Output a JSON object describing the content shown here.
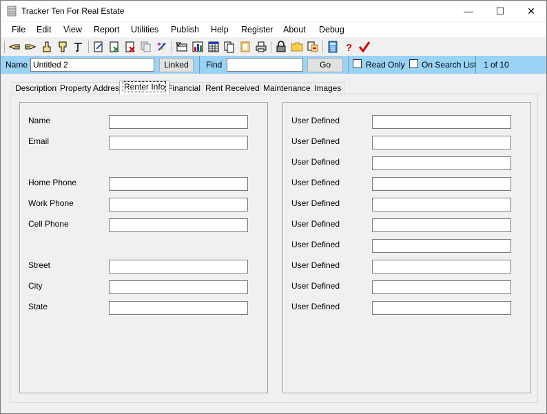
{
  "window": {
    "title": "Tracker Ten For Real Estate",
    "minimize_glyph": "—",
    "maximize_glyph": "☐",
    "close_glyph": "✕"
  },
  "menu": [
    "File",
    "Edit",
    "View",
    "Report",
    "Utilities",
    "Publish",
    "Help",
    "Register",
    "About",
    "Debug"
  ],
  "toolbar": {
    "icons": [
      "pointing-hand-left-icon",
      "pointing-hand-right-icon",
      "hand-up-icon",
      "hand-down-icon",
      "hand-tool-icon",
      "edit-record-icon",
      "delete-record-icon",
      "copy-record-icon",
      "duplicate-record-icon",
      "sparkle-icon",
      "form-view-icon",
      "chart-icon",
      "grid-icon",
      "documents-icon",
      "film-icon",
      "print-icon",
      "lock-icon",
      "folder-icon",
      "import-icon",
      "calculator-icon",
      "help-icon",
      "checkmark-icon"
    ]
  },
  "searchbar": {
    "name_label": "Name",
    "name_value": "Untitled 2",
    "linked_label": "Linked",
    "find_label": "Find",
    "find_value": "",
    "go_label": "Go",
    "read_only_label": "Read Only",
    "on_search_list_label": "On Search List",
    "record_counter": "1 of 10"
  },
  "tabs": [
    "Description",
    "Property Address",
    "Renter Info",
    "Financial",
    "Rent Received",
    "Maintenance",
    "Images"
  ],
  "active_tab": "Renter Info",
  "renter_fields": {
    "name": {
      "label": "Name",
      "value": ""
    },
    "email": {
      "label": "Email",
      "value": ""
    },
    "home_phone": {
      "label": "Home Phone",
      "value": ""
    },
    "work_phone": {
      "label": "Work Phone",
      "value": ""
    },
    "cell_phone": {
      "label": "Cell Phone",
      "value": ""
    },
    "street": {
      "label": "Street",
      "value": ""
    },
    "city": {
      "label": "City",
      "value": ""
    },
    "state": {
      "label": "State",
      "value": ""
    }
  },
  "user_defined": [
    {
      "label": "User Defined",
      "value": ""
    },
    {
      "label": "User Defined",
      "value": ""
    },
    {
      "label": "User Defined",
      "value": ""
    },
    {
      "label": "User Defined",
      "value": ""
    },
    {
      "label": "User Defined",
      "value": ""
    },
    {
      "label": "User Defined",
      "value": ""
    },
    {
      "label": "User Defined",
      "value": ""
    },
    {
      "label": "User Defined",
      "value": ""
    },
    {
      "label": "User Defined",
      "value": ""
    },
    {
      "label": "User Defined",
      "value": ""
    }
  ],
  "colors": {
    "search_bar_bg": "#99d3f5",
    "window_bg": "#f0f0f0",
    "checkmark": "#d40000"
  }
}
